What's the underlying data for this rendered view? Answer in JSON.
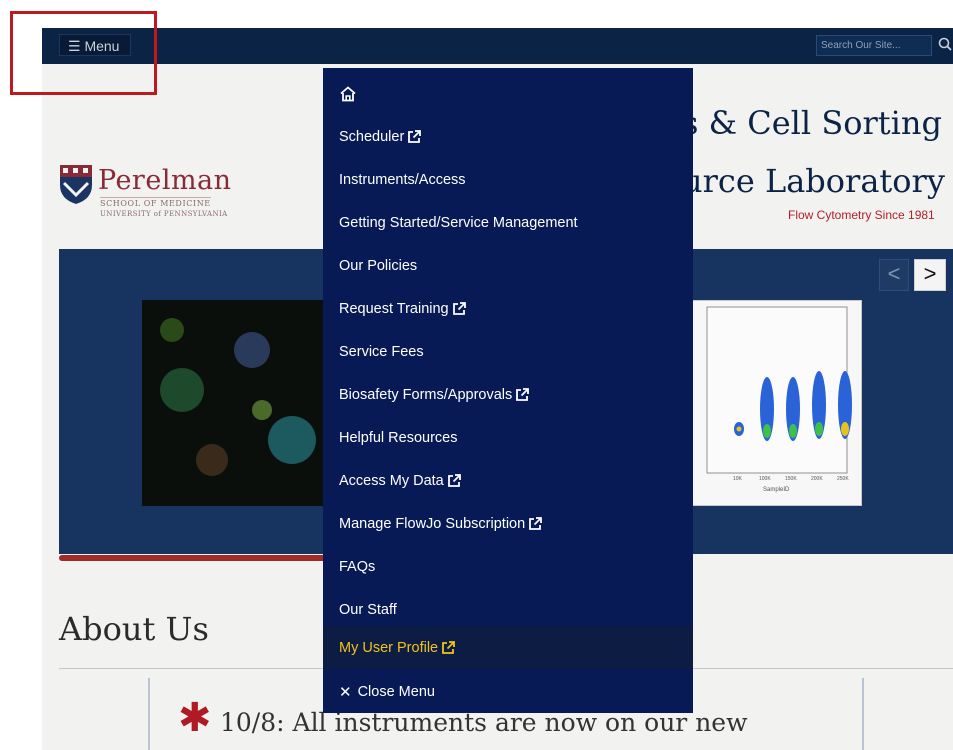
{
  "header": {
    "menu_button": "☰ Menu",
    "search_placeholder": "Search Our Site..."
  },
  "logo": {
    "name": "Perelman",
    "line1": "SCHOOL OF MEDICINE",
    "line2": "UNIVERSITY of PENNSYLVANIA"
  },
  "site": {
    "title_line1": "s & Cell Sorting",
    "title_line2": "urce Laboratory",
    "tagline": "Flow Cytometry Since 1981"
  },
  "carousel": {
    "prev": "<",
    "next": ">",
    "plot_xlabel": "SampleID",
    "plot_ticks": [
      "10K",
      "100K",
      "150K",
      "200K",
      "250K"
    ]
  },
  "main": {
    "heading": "About Us",
    "notice": "10/8: All instruments are now on our new"
  },
  "menu": {
    "items": [
      {
        "label": "",
        "icon": "home-icon"
      },
      {
        "label": "Scheduler",
        "external": true
      },
      {
        "label": "Instruments/Access"
      },
      {
        "label": "Getting Started/Service Management"
      },
      {
        "label": "Our Policies"
      },
      {
        "label": "Request Training",
        "external": true
      },
      {
        "label": "Service Fees"
      },
      {
        "label": "Biosafety Forms/Approvals",
        "external": true
      },
      {
        "label": "Helpful Resources"
      },
      {
        "label": "Access My Data",
        "external": true
      },
      {
        "label": "Manage FlowJo Subscription",
        "external": true
      },
      {
        "label": "FAQs"
      },
      {
        "label": "Our Staff"
      },
      {
        "label": "My User Profile",
        "external": true,
        "active": true
      }
    ],
    "close_label": "Close Menu"
  },
  "colors": {
    "navy": "#0b2345",
    "menu_bg": "#071a55",
    "active_text": "#f2c21b",
    "accent_red": "#b21e28"
  }
}
